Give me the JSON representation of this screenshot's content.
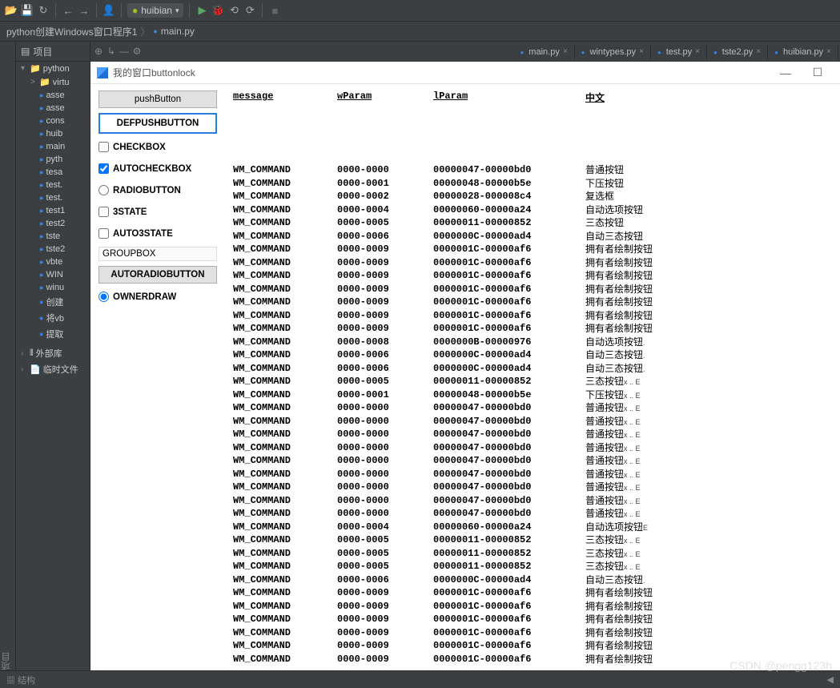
{
  "toolbar": {
    "run_config": "huibian"
  },
  "breadcrumb": {
    "project": "python创建Windows窗口程序1",
    "file": "main.py"
  },
  "tree": {
    "header": "项目",
    "root": "python",
    "items": [
      {
        "lvl": 2,
        "icon": "dir",
        "label": "virtu",
        "arrow": ">"
      },
      {
        "lvl": 2,
        "icon": "py",
        "label": "asse"
      },
      {
        "lvl": 2,
        "icon": "py",
        "label": "asse"
      },
      {
        "lvl": 2,
        "icon": "py",
        "label": "cons"
      },
      {
        "lvl": 2,
        "icon": "py",
        "label": "huib"
      },
      {
        "lvl": 2,
        "icon": "py",
        "label": "main"
      },
      {
        "lvl": 2,
        "icon": "py",
        "label": "pyth"
      },
      {
        "lvl": 2,
        "icon": "py",
        "label": "tesa"
      },
      {
        "lvl": 2,
        "icon": "py",
        "label": "test."
      },
      {
        "lvl": 2,
        "icon": "py",
        "label": "test."
      },
      {
        "lvl": 2,
        "icon": "py",
        "label": "test1"
      },
      {
        "lvl": 2,
        "icon": "py",
        "label": "test2"
      },
      {
        "lvl": 2,
        "icon": "py",
        "label": "tste"
      },
      {
        "lvl": 2,
        "icon": "py",
        "label": "tste2"
      },
      {
        "lvl": 2,
        "icon": "py",
        "label": "vbte"
      },
      {
        "lvl": 2,
        "icon": "py",
        "label": "WIN"
      },
      {
        "lvl": 2,
        "icon": "py",
        "label": "winu"
      },
      {
        "lvl": 2,
        "icon": "py",
        "label": "创建"
      },
      {
        "lvl": 2,
        "icon": "py",
        "label": "将vb"
      },
      {
        "lvl": 2,
        "icon": "py",
        "label": "提取"
      }
    ],
    "libs": "外部库",
    "scratch": "临时文件"
  },
  "tabs": [
    {
      "label": "main.py"
    },
    {
      "label": "wintypes.py"
    },
    {
      "label": "test.py"
    },
    {
      "label": "tste2.py"
    },
    {
      "label": "huibian.py"
    }
  ],
  "win": {
    "title": "我的窗口buttonlock",
    "controls": {
      "pushButton": "pushButton",
      "defPush": "DEFPUSHBUTTON",
      "checkbox": "CHECKBOX",
      "autocheck": "AUTOCHECKBOX",
      "radio": "RADIOBUTTON",
      "state3": "3STATE",
      "auto3state": "AUTO3STATE",
      "groupbox": "GROUPBOX",
      "autoradio": "AUTORADIOBUTTON",
      "ownerdraw": "OWNERDRAW"
    },
    "headers": {
      "c1": "message",
      "c2": "wParam",
      "c3": "lParam",
      "c4": "中文"
    },
    "rows": [
      {
        "c1": "WM_COMMAND",
        "c2": "0000-0000",
        "c3": "00000047-00000bd0",
        "c4": "普通按钮",
        "suf": ""
      },
      {
        "c1": "WM_COMMAND",
        "c2": "0000-0001",
        "c3": "00000048-00000b5e",
        "c4": "下压按钮",
        "suf": ""
      },
      {
        "c1": "WM_COMMAND",
        "c2": "0000-0002",
        "c3": "00000028-000008c4",
        "c4": "复选框",
        "suf": ""
      },
      {
        "c1": "WM_COMMAND",
        "c2": "0000-0004",
        "c3": "00000060-00000a24",
        "c4": "自动选项按钮",
        "suf": ""
      },
      {
        "c1": "WM_COMMAND",
        "c2": "0000-0005",
        "c3": "00000011-00000852",
        "c4": "三态按钮",
        "suf": ""
      },
      {
        "c1": "WM_COMMAND",
        "c2": "0000-0006",
        "c3": "0000000C-00000ad4",
        "c4": "自动三态按钮",
        "suf": ""
      },
      {
        "c1": "WM_COMMAND",
        "c2": "0000-0009",
        "c3": "0000001C-00000af6",
        "c4": "拥有者绘制按钮",
        "suf": ""
      },
      {
        "c1": "WM_COMMAND",
        "c2": "0000-0009",
        "c3": "0000001C-00000af6",
        "c4": "拥有者绘制按钮",
        "suf": ""
      },
      {
        "c1": "WM_COMMAND",
        "c2": "0000-0009",
        "c3": "0000001C-00000af6",
        "c4": "拥有者绘制按钮",
        "suf": ""
      },
      {
        "c1": "WM_COMMAND",
        "c2": "0000-0009",
        "c3": "0000001C-00000af6",
        "c4": "拥有者绘制按钮",
        "suf": ""
      },
      {
        "c1": "WM_COMMAND",
        "c2": "0000-0009",
        "c3": "0000001C-00000af6",
        "c4": "拥有者绘制按钮",
        "suf": ""
      },
      {
        "c1": "WM_COMMAND",
        "c2": "0000-0009",
        "c3": "0000001C-00000af6",
        "c4": "拥有者绘制按钮",
        "suf": ""
      },
      {
        "c1": "WM_COMMAND",
        "c2": "0000-0009",
        "c3": "0000001C-00000af6",
        "c4": "拥有者绘制按钮",
        "suf": ""
      },
      {
        "c1": "WM_COMMAND",
        "c2": "0000-0008",
        "c3": "0000000B-00000976",
        "c4": "自动选项按钮",
        "suf": "."
      },
      {
        "c1": "WM_COMMAND",
        "c2": "0000-0006",
        "c3": "0000000C-00000ad4",
        "c4": "自动三态按钮",
        "suf": "."
      },
      {
        "c1": "WM_COMMAND",
        "c2": "0000-0006",
        "c3": "0000000C-00000ad4",
        "c4": "自动三态按钮",
        "suf": "."
      },
      {
        "c1": "WM_COMMAND",
        "c2": "0000-0005",
        "c3": "00000011-00000852",
        "c4": "三态按钮",
        "suf": "x .. E"
      },
      {
        "c1": "WM_COMMAND",
        "c2": "0000-0001",
        "c3": "00000048-00000b5e",
        "c4": "下压按钮",
        "suf": "x .. E"
      },
      {
        "c1": "WM_COMMAND",
        "c2": "0000-0000",
        "c3": "00000047-00000bd0",
        "c4": "普通按钮",
        "suf": "x .. E"
      },
      {
        "c1": "WM_COMMAND",
        "c2": "0000-0000",
        "c3": "00000047-00000bd0",
        "c4": "普通按钮",
        "suf": "x .. E"
      },
      {
        "c1": "WM_COMMAND",
        "c2": "0000-0000",
        "c3": "00000047-00000bd0",
        "c4": "普通按钮",
        "suf": "x .. E"
      },
      {
        "c1": "WM_COMMAND",
        "c2": "0000-0000",
        "c3": "00000047-00000bd0",
        "c4": "普通按钮",
        "suf": "x .. E"
      },
      {
        "c1": "WM_COMMAND",
        "c2": "0000-0000",
        "c3": "00000047-00000bd0",
        "c4": "普通按钮",
        "suf": "x .. E"
      },
      {
        "c1": "WM_COMMAND",
        "c2": "0000-0000",
        "c3": "00000047-00000bd0",
        "c4": "普通按钮",
        "suf": "x .. E"
      },
      {
        "c1": "WM_COMMAND",
        "c2": "0000-0000",
        "c3": "00000047-00000bd0",
        "c4": "普通按钮",
        "suf": "x .. E"
      },
      {
        "c1": "WM_COMMAND",
        "c2": "0000-0000",
        "c3": "00000047-00000bd0",
        "c4": "普通按钮",
        "suf": "x .. E"
      },
      {
        "c1": "WM_COMMAND",
        "c2": "0000-0000",
        "c3": "00000047-00000bd0",
        "c4": "普通按钮",
        "suf": "x .. E"
      },
      {
        "c1": "WM_COMMAND",
        "c2": "0000-0004",
        "c3": "00000060-00000a24",
        "c4": "自动选项按钮",
        "suf": "E"
      },
      {
        "c1": "WM_COMMAND",
        "c2": "0000-0005",
        "c3": "00000011-00000852",
        "c4": "三态按钮",
        "suf": "x .. E"
      },
      {
        "c1": "WM_COMMAND",
        "c2": "0000-0005",
        "c3": "00000011-00000852",
        "c4": "三态按钮",
        "suf": "x .. E"
      },
      {
        "c1": "WM_COMMAND",
        "c2": "0000-0005",
        "c3": "00000011-00000852",
        "c4": "三态按钮",
        "suf": "x .. E"
      },
      {
        "c1": "WM_COMMAND",
        "c2": "0000-0006",
        "c3": "0000000C-00000ad4",
        "c4": "自动三态按钮",
        "suf": "."
      },
      {
        "c1": "WM_COMMAND",
        "c2": "0000-0009",
        "c3": "0000001C-00000af6",
        "c4": "拥有者绘制按钮",
        "suf": ""
      },
      {
        "c1": "WM_COMMAND",
        "c2": "0000-0009",
        "c3": "0000001C-00000af6",
        "c4": "拥有者绘制按钮",
        "suf": ""
      },
      {
        "c1": "WM_COMMAND",
        "c2": "0000-0009",
        "c3": "0000001C-00000af6",
        "c4": "拥有者绘制按钮",
        "suf": ""
      },
      {
        "c1": "WM_COMMAND",
        "c2": "0000-0009",
        "c3": "0000001C-00000af6",
        "c4": "拥有者绘制按钮",
        "suf": ""
      },
      {
        "c1": "WM_COMMAND",
        "c2": "0000-0009",
        "c3": "0000001C-00000af6",
        "c4": "拥有者绘制按钮",
        "suf": ""
      },
      {
        "c1": "WM_COMMAND",
        "c2": "0000-0009",
        "c3": "0000001C-00000af6",
        "c4": "拥有者绘制按钮",
        "suf": ""
      }
    ]
  },
  "statusbar": {
    "left": "▦ 结构"
  },
  "watermark": "CSDN @pengg123h"
}
